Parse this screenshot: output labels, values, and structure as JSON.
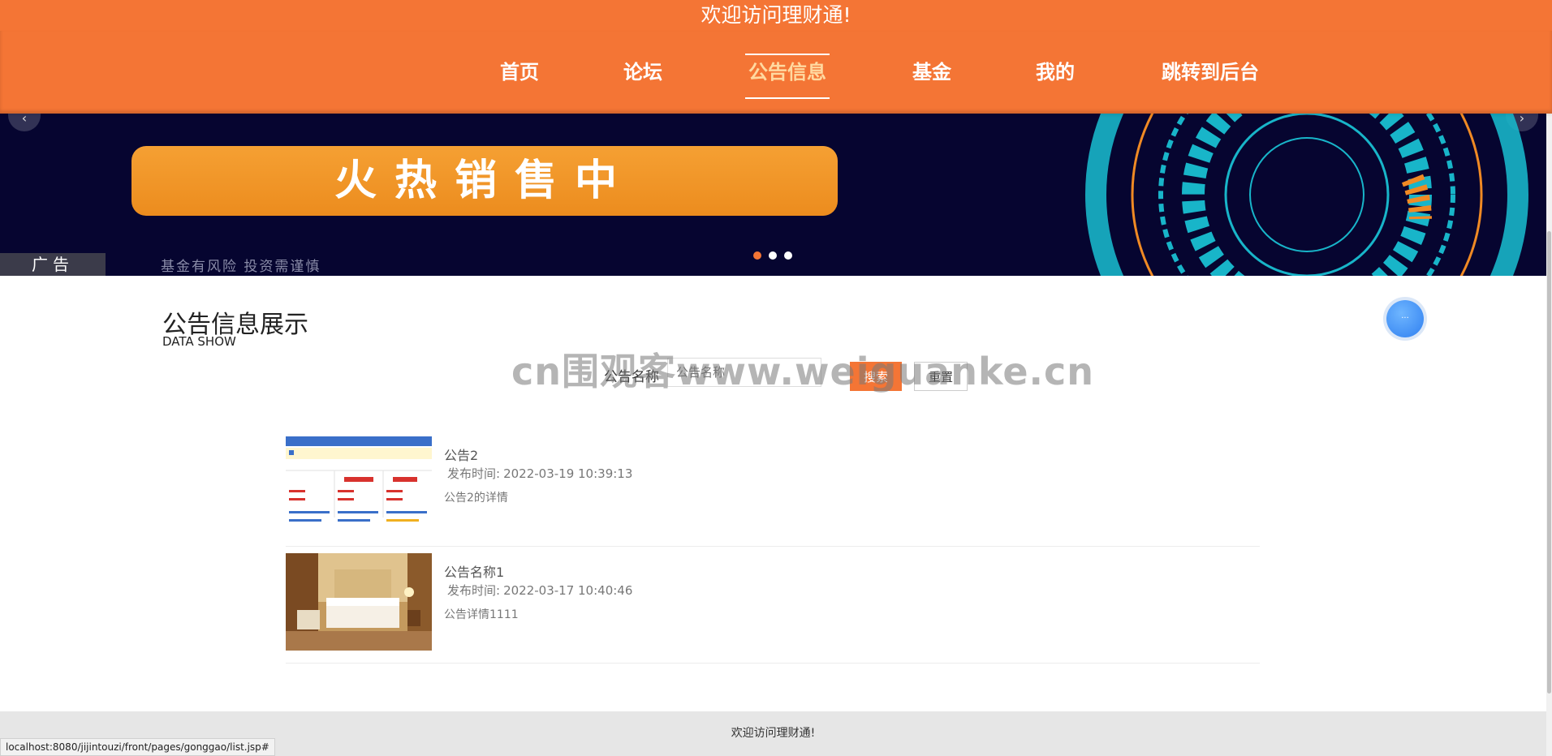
{
  "header": {
    "welcome": "欢迎访问理财通!"
  },
  "nav": {
    "items": [
      {
        "label": "首页"
      },
      {
        "label": "论坛"
      },
      {
        "label": "公告信息"
      },
      {
        "label": "基金"
      },
      {
        "label": "我的"
      },
      {
        "label": "跳转到后台"
      }
    ],
    "active_index": 2
  },
  "banner": {
    "headline": "火热销售中",
    "tag": "广告",
    "warning": "基金有风险 投资需谨慎",
    "slide_count": 3,
    "active_slide": 1
  },
  "section": {
    "title": "公告信息展示",
    "subtitle": "DATA SHOW"
  },
  "search": {
    "label": "公告名称",
    "placeholder": "公告名称",
    "search_label": "搜索",
    "reset_label": "重置"
  },
  "announcements": [
    {
      "title": "公告2",
      "time_label": "发布时间:",
      "time": "2022-03-19 10:39:13",
      "desc": "公告2的详情",
      "thumb": "fund-screenshot"
    },
    {
      "title": "公告名称1",
      "time_label": "发布时间:",
      "time": "2022-03-17 10:40:46",
      "desc": "公告详情1111",
      "thumb": "hotel-room"
    }
  ],
  "footer": {
    "text": "欢迎访问理财通!"
  },
  "status_bar": {
    "url": "localhost:8080/jijintouzi/front/pages/gonggao/list.jsp#"
  },
  "watermark": "cn围观客www.weiguanke.cn",
  "colors": {
    "brand": "#f47535",
    "banner_bg": "#060530",
    "footer_bg": "#e6e6e6"
  }
}
